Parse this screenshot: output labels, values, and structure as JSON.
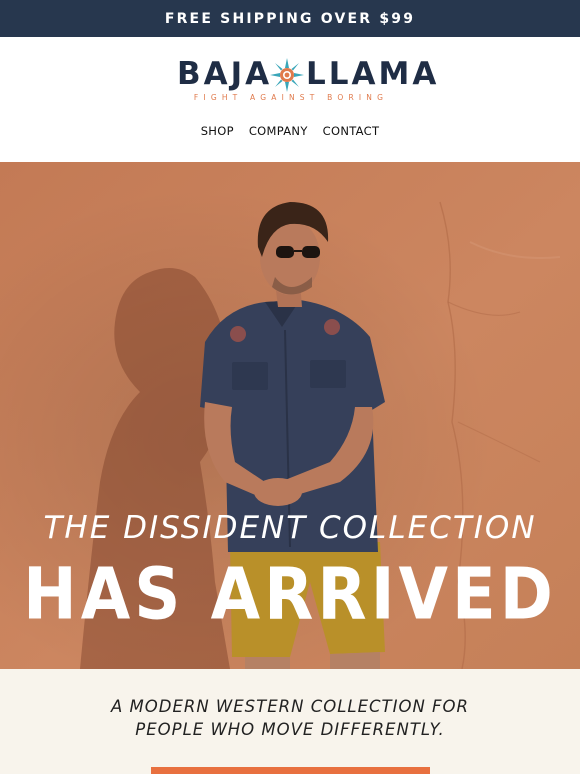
{
  "promo": {
    "text": "FREE SHIPPING OVER $99"
  },
  "brand": {
    "name_left": "BAJA",
    "name_right": "LLAMA",
    "tagline": "FIGHT AGAINST BORING",
    "logo_icon": "sun-icon",
    "colors": {
      "navy": "#1f2d45",
      "orange": "#e07a4c",
      "teal": "#3aa6b9"
    }
  },
  "nav": {
    "items": [
      "SHOP",
      "COMPANY",
      "CONTACT"
    ]
  },
  "hero": {
    "subtitle": "THE DISSIDENT COLLECTION",
    "title": "HAS ARRIVED",
    "image": "man-in-western-shirt-against-terracotta-wall"
  },
  "intro": {
    "line1": "A MODERN WESTERN COLLECTION FOR",
    "line2": "PEOPLE WHO MOVE DIFFERENTLY.",
    "cta_color": "#e8703f"
  }
}
